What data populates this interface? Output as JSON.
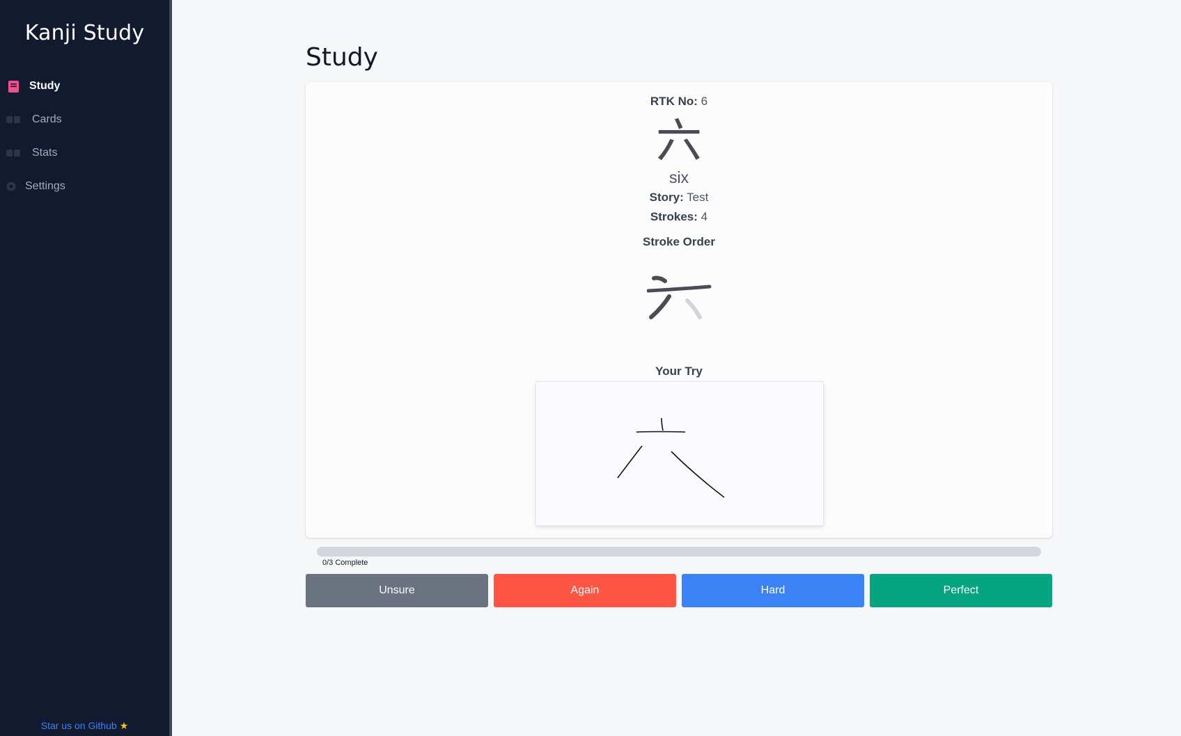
{
  "app": {
    "title": "Kanji Study"
  },
  "sidebar": {
    "items": [
      {
        "label": "Study",
        "icon": "book-icon",
        "active": true
      },
      {
        "label": "Cards",
        "icon": "cards-icon",
        "active": false
      },
      {
        "label": "Stats",
        "icon": "chart-icon",
        "active": false
      },
      {
        "label": "Settings",
        "icon": "gear-icon",
        "active": false
      }
    ],
    "footer_link": "Star us on Github",
    "footer_star": "★"
  },
  "main": {
    "page_title": "Study"
  },
  "card": {
    "rtk_label": "RTK No:",
    "rtk_value": "6",
    "kanji": "六",
    "meaning": "six",
    "story_label": "Story:",
    "story_value": "Test",
    "strokes_label": "Strokes:",
    "strokes_value": "4",
    "stroke_order_heading": "Stroke Order",
    "your_try_heading": "Your Try"
  },
  "progress": {
    "completed": 0,
    "total": 3,
    "label": "0/3 Complete"
  },
  "actions": [
    {
      "label": "Unsure",
      "color": "#6b7280"
    },
    {
      "label": "Again",
      "color": "#ff5544"
    },
    {
      "label": "Hard",
      "color": "#3b82f6"
    },
    {
      "label": "Perfect",
      "color": "#06a582"
    }
  ],
  "colors": {
    "sidebar_bg": "#111a2e",
    "active_icon": "#f0508c",
    "link": "#3b82f6"
  }
}
